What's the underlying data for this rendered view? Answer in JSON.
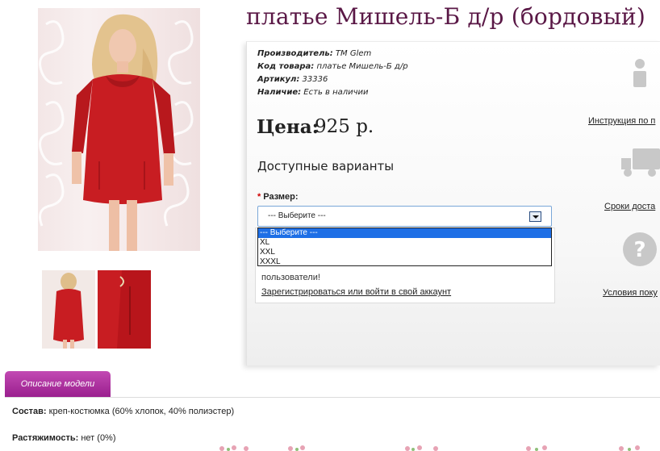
{
  "product": {
    "title": "платье Мишель-Б д/р (бордовый)",
    "manufacturer_label": "Производитель:",
    "manufacturer_value": "ТМ Glem",
    "code_label": "Код товара:",
    "code_value": "платье Мишель-Б д/р",
    "article_label": "Артикул:",
    "article_value": "33336",
    "stock_label": "Наличие:",
    "stock_value": "Есть в наличии",
    "price_label": "Цена:",
    "price_value": "925 р.",
    "variants_title": "Доступные варианты",
    "size_label": "Размер:",
    "size_required": "*",
    "size_selected": "--- Выберите ---",
    "size_options": [
      "--- Выберите ---",
      "XL",
      "XXL",
      "XXXL"
    ]
  },
  "login_note": {
    "text": "пользователи!",
    "link": "Зарегистрироваться или войти в свой аккаунт"
  },
  "sidebar": {
    "instruction_link": "Инструкция по п",
    "delivery_link": "Сроки доста",
    "terms_link": "Условия поку",
    "icons": [
      "info-icon",
      "truck-icon",
      "question-icon"
    ]
  },
  "tabs": {
    "description_tab": "Описание модели"
  },
  "description": {
    "composition_label": "Состав:",
    "composition_value": "креп-костюмка (60% хлопок, 40% полиэстер)",
    "stretch_label": "Растяжимость:",
    "stretch_value": "нет (0%)"
  },
  "colors": {
    "title": "#5a1846",
    "tab": "#a62798",
    "dress": "#c81d22",
    "selected_option": "#1e6fe6"
  }
}
